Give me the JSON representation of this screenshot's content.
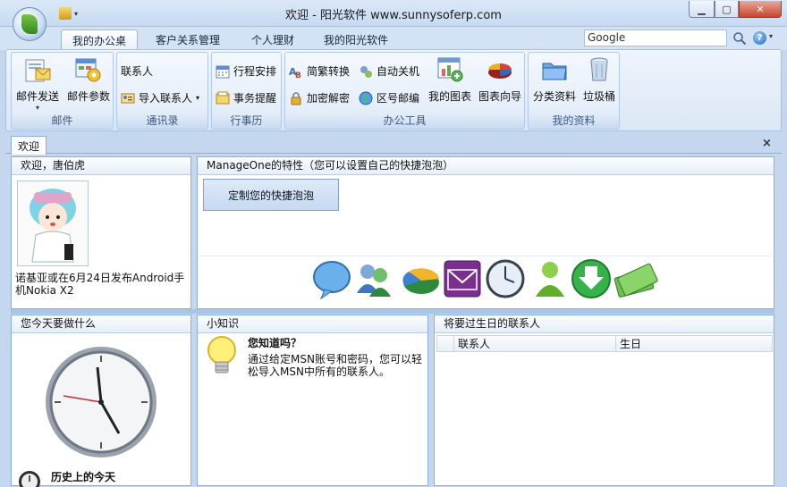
{
  "window": {
    "title": "欢迎 - 阳光软件 www.sunnysoferp.com",
    "controls": {
      "minimize": "▁",
      "maximize": "▢",
      "close": "✕"
    }
  },
  "tabs": [
    {
      "label": "我的办公桌",
      "active": true
    },
    {
      "label": "客户关系管理",
      "active": false
    },
    {
      "label": "个人理财",
      "active": false
    },
    {
      "label": "我的阳光软件",
      "active": false
    }
  ],
  "search": {
    "value": "Google"
  },
  "help": {
    "glyph": "?",
    "dropdown": "▾"
  },
  "ribbon": {
    "groups": {
      "mail": {
        "label": "邮件",
        "send": "邮件发送",
        "send_dd": "▾",
        "params": "邮件参数"
      },
      "contacts": {
        "label": "通讯录",
        "contact": "联系人",
        "import": "导入联系人",
        "import_dd": "▾"
      },
      "calendar": {
        "label": "行事历",
        "schedule": "行程安排",
        "reminder": "事务提醒"
      },
      "tools": {
        "label": "办公工具",
        "convert": "简繁转换",
        "encrypt": "加密解密",
        "shutdown": "自动关机",
        "zipcode": "区号邮编",
        "mychart": "我的图表",
        "chartwizard": "图表向导"
      },
      "mydata": {
        "label": "我的资料",
        "classify": "分类资料",
        "trash": "垃圾桶"
      }
    }
  },
  "doc_tab": {
    "label": "欢迎",
    "close": "×"
  },
  "welcome": {
    "header": "欢迎，唐伯虎",
    "news": "诺基亚或在6月24日发布Android手机Nokia X2"
  },
  "features": {
    "header": "ManageOne的特性（您可以设置自己的快捷泡泡）",
    "customize_button": "定制您的快捷泡泡",
    "bubbles": [
      "chat-bubble-icon",
      "users-icon",
      "pie-chart-icon",
      "mail-icon",
      "clock-icon",
      "user-green-icon",
      "download-icon",
      "money-icon"
    ]
  },
  "todo": {
    "header": "您今天要做什么",
    "history_title": "历史上的今天"
  },
  "tips": {
    "header": "小知识",
    "title": "您知道吗？",
    "body": "通过给定MSN账号和密码，您可以轻松导入MSN中所有的联系人。"
  },
  "birthdays": {
    "header": "将要过生日的联系人",
    "columns": [
      "联系人",
      "生日"
    ],
    "rows": []
  },
  "colors": {
    "accent": "#1e395b",
    "panel_border": "#8eaed8",
    "frame": "#c4d7ee"
  }
}
